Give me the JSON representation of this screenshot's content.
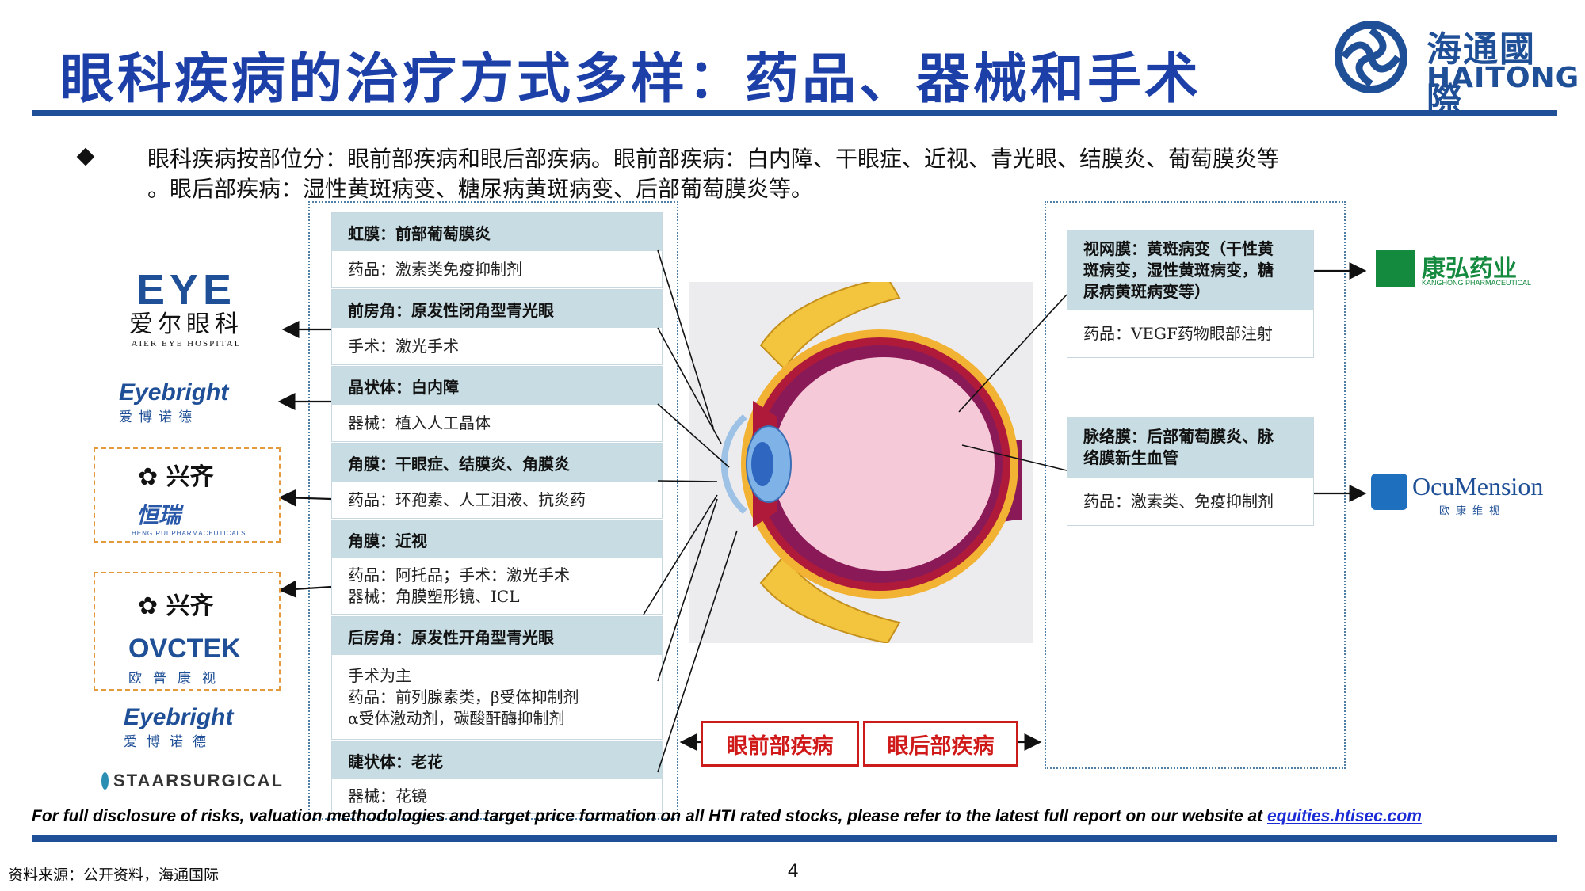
{
  "header": {
    "title": "眼科疾病的治疗方式多样：药品、器械和手术",
    "logo_cn": "海通國際",
    "logo_en": "HAITONG"
  },
  "bullet": {
    "line1": "眼科疾病按部位分：眼前部疾病和眼后部疾病。眼前部疾病：白内障、干眼症、近视、青光眼、结膜炎、葡萄膜炎等",
    "line2": "。眼后部疾病：湿性黄斑病变、糖尿病黄斑病变、后部葡萄膜炎等。"
  },
  "anterior": [
    {
      "head": "虹膜：前部葡萄膜炎",
      "body": [
        "药品：激素类免疫抑制剂"
      ]
    },
    {
      "head": "前房角：原发性闭角型青光眼",
      "body": [
        "手术：激光手术"
      ]
    },
    {
      "head": "晶状体：白内障",
      "body": [
        "器械：植入人工晶体"
      ]
    },
    {
      "head": "角膜：干眼症、结膜炎、角膜炎",
      "body": [
        "药品：环孢素、人工泪液、抗炎药"
      ]
    },
    {
      "head": "角膜：近视",
      "body": [
        "药品：阿托品；手术：激光手术",
        "器械：角膜塑形镜、ICL"
      ]
    },
    {
      "head": "后房角：原发性开角型青光眼",
      "body": [
        "手术为主",
        "药品：前列腺素类，β受体抑制剂",
        "α受体激动剂，碳酸酐酶抑制剂"
      ]
    },
    {
      "head": "睫状体：老花",
      "body": [
        "器械：花镜"
      ]
    }
  ],
  "posterior": [
    {
      "head": [
        "视网膜：黄斑病变（干性黄",
        "斑病变，湿性黄斑病变，糖",
        "尿病黄斑病变等）"
      ],
      "body": "药品：VEGF药物眼部注射"
    },
    {
      "head": [
        "脉络膜：后部葡萄膜炎、脉",
        "络膜新生血管"
      ],
      "body": "药品：激素类、免疫抑制剂"
    }
  ],
  "brands_left": {
    "aier": {
      "logo": "EYE",
      "cn": "爱尔眼科",
      "en": "AIER EYE HOSPITAL"
    },
    "eyebright1": {
      "en": "Eyebright",
      "cn": "爱博诺德"
    },
    "xingqi1": {
      "cn": "兴齐"
    },
    "hengrui": {
      "cn": "恒瑞",
      "en": "HENG RUI PHARMACEUTICALS"
    },
    "xingqi2": {
      "cn": "兴齐"
    },
    "ovctek": {
      "en": "OVCTEK",
      "cn": "欧普康视"
    },
    "eyebright2": {
      "en": "Eyebright",
      "cn": "爱博诺德"
    },
    "staar": {
      "en": "STAARSURGICAL"
    }
  },
  "brands_right": {
    "kanghong": {
      "cn": "康弘药业",
      "en": "KANGHONG PHARMACEUTICAL"
    },
    "ocumension": {
      "en": "OcuMension",
      "cn": "欧康维视"
    }
  },
  "buttons": {
    "anterior": "眼前部疾病",
    "posterior": "眼后部疾病"
  },
  "footer": {
    "disclaimer": "For full disclosure of risks, valuation methodologies and target price formation on all HTI rated stocks, please refer to the latest full report on our website at ",
    "link": "equities.htisec.com",
    "source": "资料来源：公开资料，海通国际",
    "page": "4"
  },
  "colors": {
    "brand_blue": "#1f4f96",
    "title_blue": "#1d3fa8",
    "red": "#d01919",
    "box_head": "#c8dde3"
  }
}
